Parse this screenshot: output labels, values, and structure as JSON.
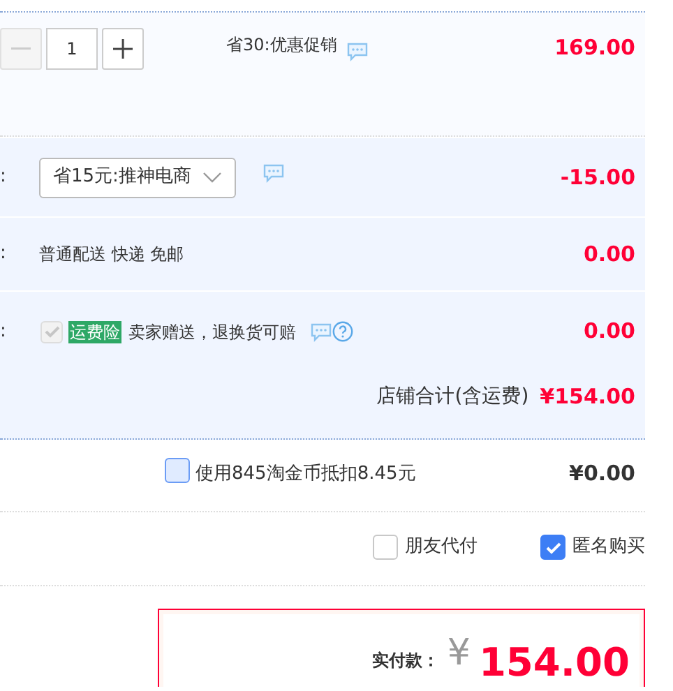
{
  "quantity": {
    "value": "1",
    "minus_disabled": true
  },
  "promo": {
    "text": "省30:优惠促销"
  },
  "item_price": "169.00",
  "discount": {
    "label": ":",
    "selection": "省15元:推神电商",
    "amount": "-15.00"
  },
  "shipping": {
    "label": ":",
    "text": "普通配送 快递 免邮",
    "amount": "0.00"
  },
  "insurance": {
    "label": ":",
    "checked": true,
    "disabled": true,
    "badge": "运费险",
    "text": "卖家赠送，退换货可赔",
    "amount": "0.00"
  },
  "store_total": {
    "label": "店铺合计(含运费)",
    "amount": "¥154.00"
  },
  "coins": {
    "checked": false,
    "text": "使用845淘金币抵扣8.45元",
    "amount": "¥0.00"
  },
  "options": [
    {
      "label": "朋友代付",
      "checked": false
    },
    {
      "label": "匿名购买",
      "checked": true
    }
  ],
  "payment": {
    "label": "实付款：",
    "currency": "¥",
    "amount": "154.00"
  }
}
